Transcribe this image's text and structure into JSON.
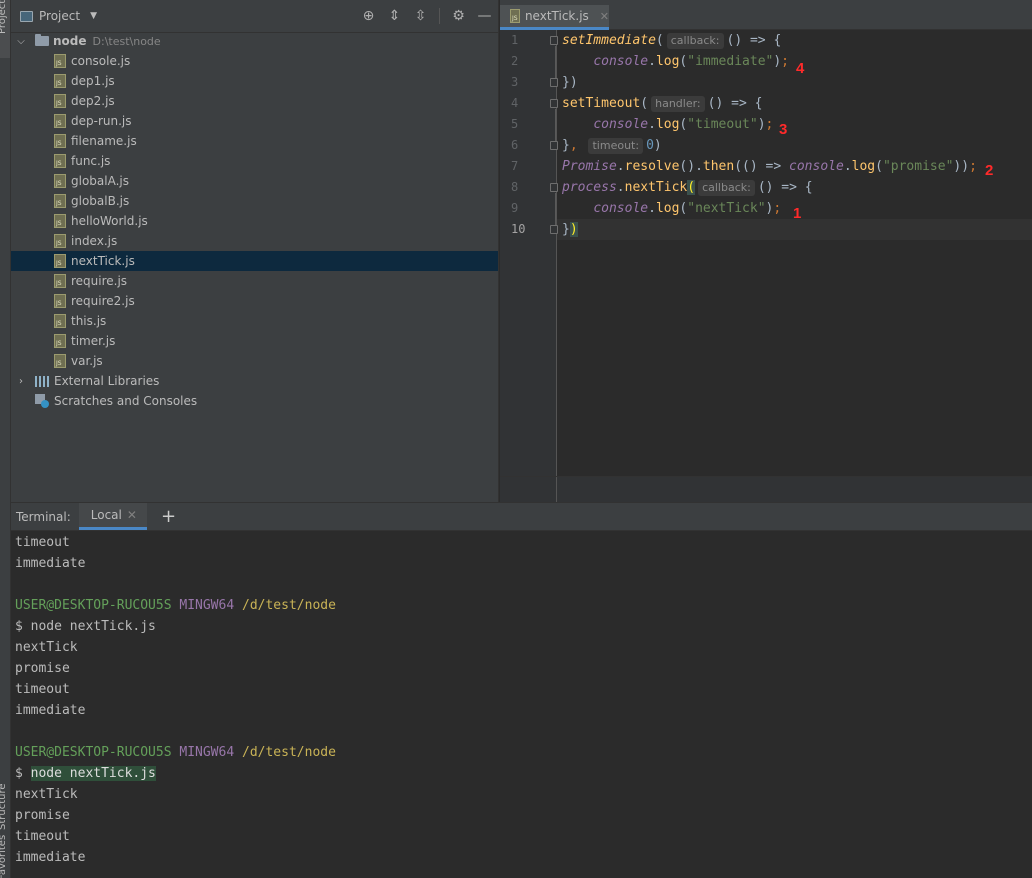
{
  "sidebar_tabs": {
    "project": "Project",
    "structure": "Structure",
    "favorites": "Favorites"
  },
  "project_panel": {
    "title": "Project",
    "root": {
      "name": "node",
      "path": "D:\\test\\node"
    },
    "files": [
      "console.js",
      "dep1.js",
      "dep2.js",
      "dep-run.js",
      "filename.js",
      "func.js",
      "globalA.js",
      "globalB.js",
      "helloWorld.js",
      "index.js",
      "nextTick.js",
      "require.js",
      "require2.js",
      "this.js",
      "timer.js",
      "var.js"
    ],
    "selected_file": "nextTick.js",
    "external_libraries": "External Libraries",
    "scratches": "Scratches and Consoles"
  },
  "editor": {
    "tab_label": "nextTick.js",
    "line_numbers": [
      "1",
      "2",
      "3",
      "4",
      "5",
      "6",
      "7",
      "8",
      "9",
      "10"
    ],
    "code": {
      "l1_fn": "setImmediate",
      "l1_open": "(",
      "l1_hint": "callback:",
      "l1_rest": "() => {",
      "l2_obj": "console",
      "l2_dot": ".",
      "l2_mth": "log",
      "l2_open": "(",
      "l2_str": "\"immediate\"",
      "l2_close": ")",
      "l2_semi": ";",
      "l3": "})",
      "l4_fn": "setTimeout",
      "l4_open": "(",
      "l4_hint": "handler:",
      "l4_rest": "() => {",
      "l5_obj": "console",
      "l5_dot": ".",
      "l5_mth": "log",
      "l5_open": "(",
      "l5_str": "\"timeout\"",
      "l5_close": ")",
      "l5_semi": ";",
      "l6_close": "}",
      "l6_comma": ",",
      "l6_hint": "timeout:",
      "l6_num": "0",
      "l6_end": ")",
      "l7_obj": "Promise",
      "l7_dot1": ".",
      "l7_resolve": "resolve",
      "l7_mid": "().",
      "l7_then": "then",
      "l7_arrow": "(() => ",
      "l7_console": "console",
      "l7_dot2": ".",
      "l7_log": "log",
      "l7_open": "(",
      "l7_str": "\"promise\"",
      "l7_close": "))",
      "l7_semi": ";",
      "l8_obj": "process",
      "l8_dot": ".",
      "l8_mth": "nextTick",
      "l8_open": "(",
      "l8_hint": "callback:",
      "l8_rest": "() => {",
      "l9_obj": "console",
      "l9_dot": ".",
      "l9_mth": "log",
      "l9_open": "(",
      "l9_str": "\"nextTick\"",
      "l9_close": ")",
      "l9_semi": ";",
      "l10_brace": "}",
      "l10_paren": ")"
    },
    "annotations": {
      "immediate": "4",
      "timeout": "3",
      "promise": "2",
      "nexttick": "1"
    },
    "annotation_color": "#ff2a2a"
  },
  "terminal": {
    "label": "Terminal:",
    "tab": "Local",
    "add": "+",
    "lines_top": [
      "timeout",
      "immediate",
      ""
    ],
    "prompt1": {
      "user": "USER@DESKTOP-RUCOU5S",
      "env": "MINGW64",
      "path": "/d/test/node"
    },
    "cmd1": {
      "dollar": "$",
      "command": "node nextTick.js"
    },
    "out1": [
      "nextTick",
      "promise",
      "timeout",
      "immediate",
      ""
    ],
    "prompt2": {
      "user": "USER@DESKTOP-RUCOU5S",
      "env": "MINGW64",
      "path": "/d/test/node"
    },
    "cmd2": {
      "dollar": "$",
      "command": "node nextTick.js"
    },
    "out2": [
      "nextTick",
      "promise",
      "timeout",
      "immediate"
    ]
  }
}
